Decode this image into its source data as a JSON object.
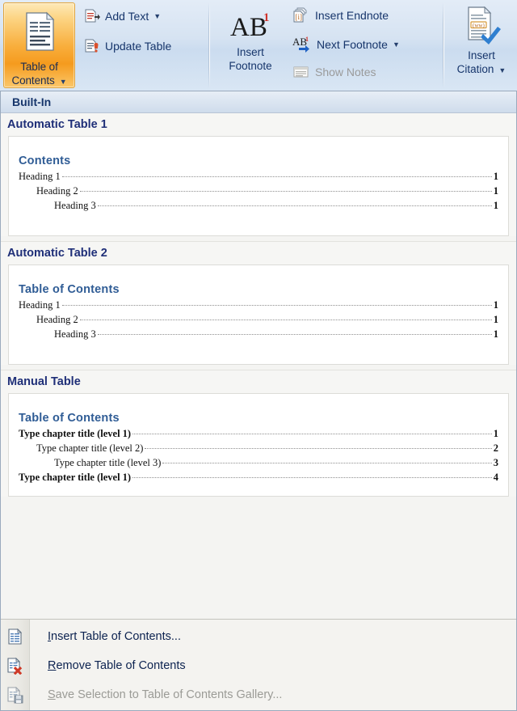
{
  "ribbon": {
    "toc_button": {
      "label_line1": "Table of",
      "label_line2": "Contents",
      "icon": "toc-document-icon",
      "state": "highlighted"
    },
    "add_text": {
      "label": "Add Text",
      "icon": "add-text-icon",
      "has_dropdown": true
    },
    "update_table": {
      "label": "Update Table",
      "icon": "update-table-icon"
    },
    "insert_footnote": {
      "label_line1": "Insert",
      "label_line2": "Footnote",
      "icon": "ab1-footnote-icon"
    },
    "insert_endnote": {
      "label": "Insert Endnote",
      "icon": "insert-endnote-icon"
    },
    "next_footnote": {
      "label": "Next Footnote",
      "icon": "next-footnote-icon",
      "has_dropdown": true
    },
    "show_notes": {
      "label": "Show Notes",
      "icon": "show-notes-icon",
      "disabled": true
    },
    "insert_citation": {
      "label_line1": "Insert",
      "label_line2": "Citation",
      "icon": "insert-citation-icon",
      "has_dropdown": true
    }
  },
  "gallery": {
    "group_header": "Built-In",
    "items": [
      {
        "title": "Automatic Table 1",
        "preview_heading": "Contents",
        "rows": [
          {
            "text": "Heading 1",
            "page": "1",
            "level": 1,
            "bold": false
          },
          {
            "text": "Heading 2",
            "page": "1",
            "level": 2,
            "bold": false
          },
          {
            "text": "Heading 3",
            "page": "1",
            "level": 3,
            "bold": false
          }
        ]
      },
      {
        "title": "Automatic Table 2",
        "preview_heading": "Table of Contents",
        "rows": [
          {
            "text": "Heading 1",
            "page": "1",
            "level": 1,
            "bold": false
          },
          {
            "text": "Heading 2",
            "page": "1",
            "level": 2,
            "bold": false
          },
          {
            "text": "Heading 3",
            "page": "1",
            "level": 3,
            "bold": false
          }
        ]
      },
      {
        "title": "Manual Table",
        "preview_heading": "Table of Contents",
        "rows": [
          {
            "text": "Type chapter title (level 1)",
            "page": "1",
            "level": 1,
            "bold": true
          },
          {
            "text": "Type chapter title (level 2)",
            "page": "2",
            "level": 2,
            "bold": false
          },
          {
            "text": "Type chapter title (level 3)",
            "page": "3",
            "level": 3,
            "bold": false
          },
          {
            "text": "Type chapter title (level 1)",
            "page": "4",
            "level": 1,
            "bold": true
          }
        ]
      }
    ]
  },
  "menu": {
    "items": [
      {
        "label": "Insert Table of Contents...",
        "accel": "I",
        "icon": "insert-toc-icon",
        "disabled": false
      },
      {
        "label": "Remove Table of Contents",
        "accel": "R",
        "icon": "remove-toc-icon",
        "disabled": false
      },
      {
        "label": "Save Selection to Table of Contents Gallery...",
        "accel": "S",
        "icon": "save-selection-icon",
        "disabled": true
      }
    ]
  },
  "colors": {
    "accent_highlight": "#f8ad3b",
    "ribbon_blue": "#d6e3f2",
    "label_blue": "#16356b",
    "title_blue": "#1f2f78",
    "preview_heading_blue": "#2f5c95"
  }
}
